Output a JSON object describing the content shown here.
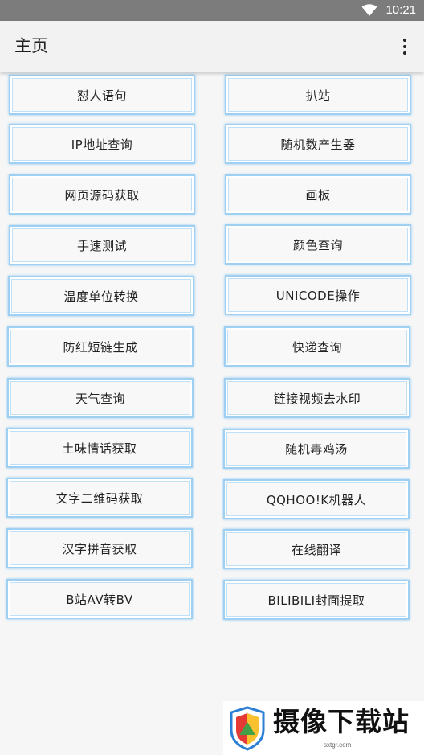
{
  "status_bar": {
    "time": "10:21",
    "wifi_icon": "wifi-icon"
  },
  "app_bar": {
    "title": "主页",
    "menu_icon": "overflow-menu-icon"
  },
  "buttons": [
    [
      "怼人语句",
      "扒站"
    ],
    [
      "IP地址查询",
      "随机数产生器"
    ],
    [
      "网页源码获取",
      "画板"
    ],
    [
      "手速测试",
      "颜色查询"
    ],
    [
      "温度单位转换",
      "UNICODE操作"
    ],
    [
      "防红短链生成",
      "快递查询"
    ],
    [
      "天气查询",
      "链接视频去水印"
    ],
    [
      "土味情话获取",
      "随机毒鸡汤"
    ],
    [
      "文字二维码获取",
      "QQHOO!K机器人"
    ],
    [
      "汉字拼音获取",
      "在线翻译"
    ],
    [
      "B站AV转BV",
      "BILIBILI封面提取"
    ]
  ],
  "watermark": {
    "text": "摄像下载站",
    "url": "sxtgr.com"
  },
  "colors": {
    "button_border": "#9fd0f2",
    "status_bar": "#7c7c7c",
    "app_bar": "#f2f2f2"
  }
}
